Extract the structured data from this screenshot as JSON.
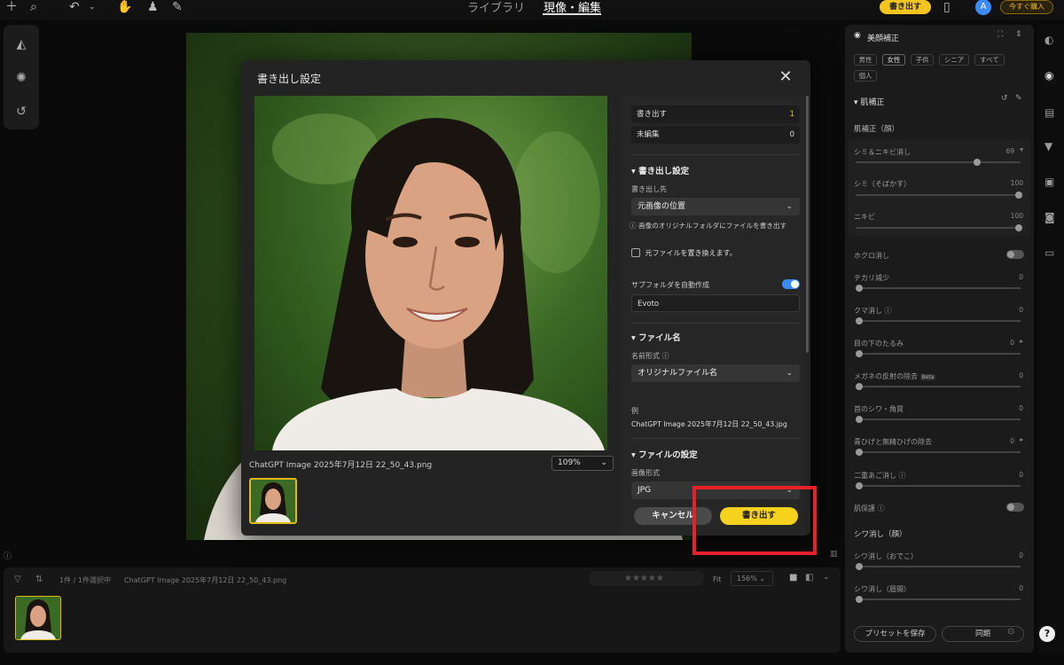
{
  "topbar": {
    "nav_library": "ライブラリ",
    "nav_develop": "現像・編集",
    "export_button": "書き出す",
    "avatar_letter": "A",
    "buy_button": "今すぐ購入"
  },
  "modal": {
    "title": "書き出し設定",
    "preview_filename": "ChatGPT Image 2025年7月12日 22_50_43.png",
    "zoom": "109%",
    "summary": {
      "export_label": "書き出す",
      "export_count": "1",
      "unedited_label": "未編集",
      "unedited_count": "0"
    },
    "export_settings": {
      "heading": "書き出し設定",
      "destination_label": "書き出し先",
      "destination_value": "元画像の位置",
      "destination_note": "画像のオリジナルフォルダにファイルを書き出す",
      "overwrite_label": "元ファイルを置き換えます。",
      "subfolder_label": "サブフォルダを自動作成",
      "subfolder_name": "Evoto"
    },
    "filename_settings": {
      "heading": "ファイル名",
      "format_label": "名前形式",
      "format_value": "オリジナルファイル名",
      "example_label": "例",
      "example_value": "ChatGPT Image 2025年7月12日 22_50_43.jpg"
    },
    "file_settings": {
      "heading": "ファイルの設定",
      "image_format_label": "画像形式",
      "image_format_value": "JPG"
    },
    "cancel_button": "キャンセル",
    "export_button": "書き出す"
  },
  "right_panel": {
    "title": "美顔補正",
    "filters": [
      "男性",
      "女性",
      "子供",
      "シニア",
      "すべて",
      "個人"
    ],
    "section_skin": "肌補正",
    "subsection_face": "肌補正（顔）",
    "sliders_top": [
      {
        "label": "シミ＆ニキビ消し",
        "value": "69",
        "pos": 0.74
      },
      {
        "label": "シミ（そばかす）",
        "value": "100",
        "pos": 1.0
      },
      {
        "label": "ニキビ",
        "value": "100",
        "pos": 1.0
      }
    ],
    "mole_label": "ホクロ消し",
    "sliders_mid": [
      {
        "label": "テカリ減少",
        "value": "0"
      },
      {
        "label": "クマ消し",
        "value": "0"
      },
      {
        "label": "目の下のたるみ",
        "value": "0"
      },
      {
        "label": "メガネの反射の除去",
        "value": "0"
      },
      {
        "label": "首のシワ・角質",
        "value": "0"
      },
      {
        "label": "青ひげと無精ひげの除去",
        "value": "0"
      },
      {
        "label": "二重あご消し",
        "value": "0"
      }
    ],
    "beta_badge": "Beta",
    "protection_label": "肌保護",
    "wrinkle_heading": "シワ消し（顔）",
    "sliders_bottom": [
      {
        "label": "シワ消し（おでこ）",
        "value": "0"
      },
      {
        "label": "シワ消し（眉間）",
        "value": "0"
      }
    ],
    "save_preset": "プリセットを保存",
    "sync": "同期"
  },
  "filmstrip": {
    "count_text": "1件 / 1件選択中",
    "filename": "ChatGPT Image 2025年7月12日 22_50_43.png",
    "fit_label": "Fit",
    "zoom": "156%"
  }
}
